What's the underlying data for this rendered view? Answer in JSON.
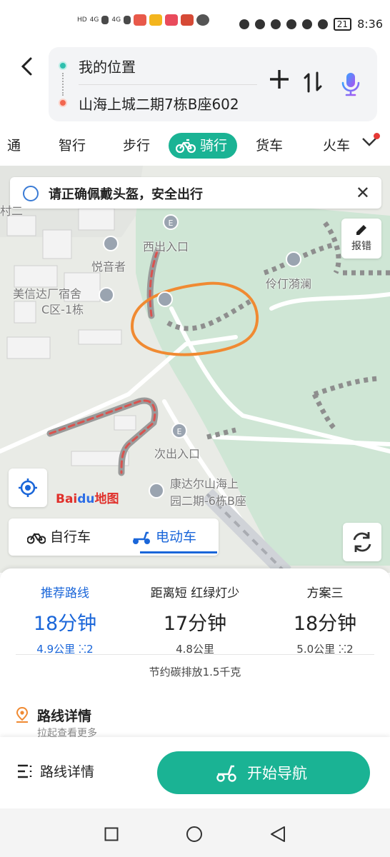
{
  "status_bar": {
    "left_labels": [
      "HD",
      "4G",
      "4G"
    ],
    "battery": "21",
    "time": "8:36"
  },
  "search": {
    "back_icon": "back-arrow-icon",
    "from": "我的位置",
    "to": "山海上城二期7栋B座602",
    "add_icon": "plus-icon",
    "swap_icon": "swap-icon",
    "voice_icon": "microphone-icon"
  },
  "tabs": {
    "items": [
      {
        "label": "通"
      },
      {
        "label": "智行"
      },
      {
        "label": "步行"
      },
      {
        "label": "骑行",
        "active": true
      },
      {
        "label": "货车"
      },
      {
        "label": "火车"
      }
    ]
  },
  "map": {
    "notice": "请正确佩戴头盔，安全出行",
    "report_label": "报错",
    "logo": {
      "bai": "Bai",
      "du": "du",
      "tail": "地图"
    },
    "labels": {
      "west_exit": "西出入口",
      "yueyin": "悦音者",
      "meixinda_1": "美信达厂宿舍",
      "meixinda_2": "C区-1栋",
      "lingding": "伶仃漪澜",
      "second_exit": "次出入口",
      "kangda_1": "康达尔山海上",
      "kangda_2": "园二期-6栋B座",
      "edge_left": "村二"
    },
    "annotation_color": "#f08a32",
    "route_color": "#d9534f"
  },
  "vehicle": {
    "bicycle": "自行车",
    "ebike": "电动车",
    "selected": "ebike"
  },
  "routes": [
    {
      "label": "推荐路线",
      "time": "18分钟",
      "distance": "4.9公里",
      "lights": "2",
      "active": true
    },
    {
      "label": "距离短 红绿灯少",
      "time": "17分钟",
      "distance": "4.8公里",
      "lights": ""
    },
    {
      "label": "方案三",
      "time": "18分钟",
      "distance": "5.0公里",
      "lights": "2"
    }
  ],
  "carbon": "节约碳排放1.5千克",
  "details": {
    "title": "路线详情",
    "subtitle": "拉起查看更多"
  },
  "actions": {
    "list_label": "路线详情",
    "start_label": "开始导航"
  },
  "colors": {
    "accent_green": "#1ab394",
    "accent_blue": "#1a66d9"
  }
}
